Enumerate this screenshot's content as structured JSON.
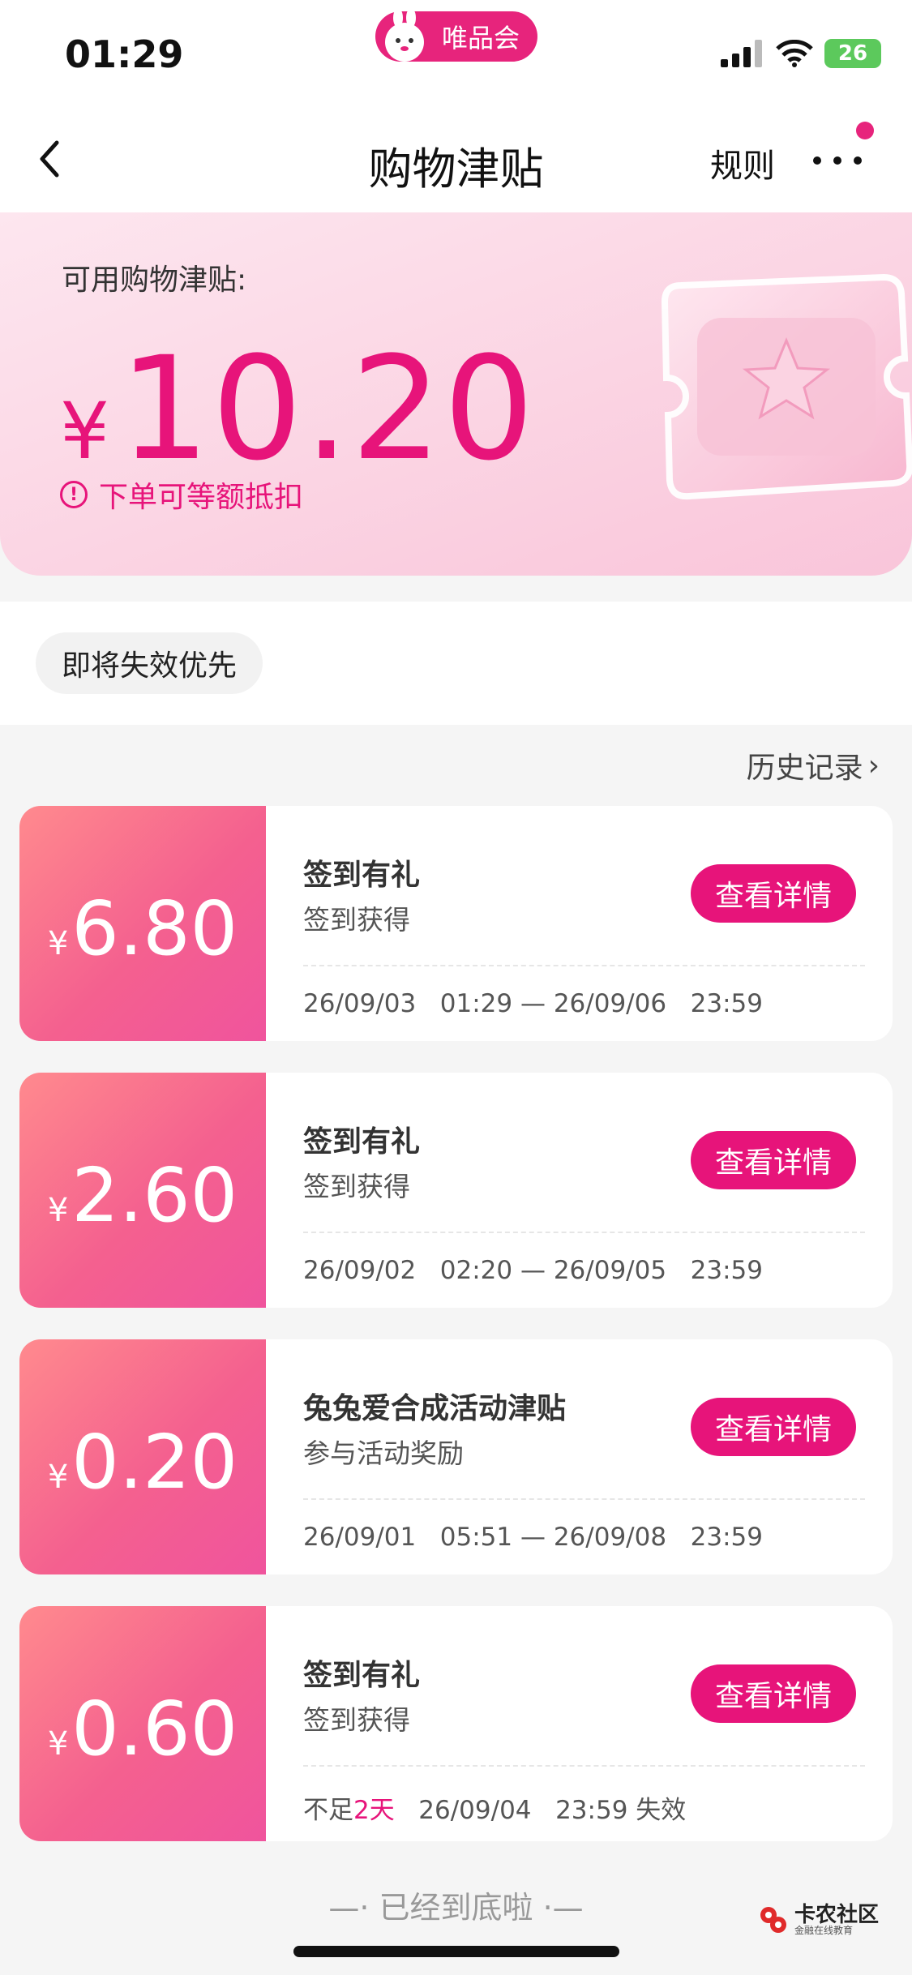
{
  "status": {
    "time": "01:29",
    "app_name": "唯品会",
    "battery": "26"
  },
  "nav": {
    "title": "购物津贴",
    "rules_label": "规则"
  },
  "hero": {
    "label": "可用购物津贴:",
    "currency": "¥",
    "amount": "10.20",
    "tip": "下单可等额抵扣",
    "tip_icon_glyph": "!"
  },
  "filter": {
    "chip_label": "即将失效优先"
  },
  "history": {
    "label": "历史记录",
    "arrow": "›"
  },
  "cards": [
    {
      "currency": "¥",
      "amount": "6.80",
      "title": "签到有礼",
      "subtitle": "签到获得",
      "button": "查看详情",
      "date_line": "26/09/03   01:29 — 26/09/06   23:59"
    },
    {
      "currency": "¥",
      "amount": "2.60",
      "title": "签到有礼",
      "subtitle": "签到获得",
      "button": "查看详情",
      "date_line": "26/09/02   02:20 — 26/09/05   23:59"
    },
    {
      "currency": "¥",
      "amount": "0.20",
      "title": "兔兔爱合成活动津贴",
      "subtitle": "参与活动奖励",
      "button": "查看详情",
      "date_line": "26/09/01   05:51 — 26/09/08   23:59"
    },
    {
      "currency": "¥",
      "amount": "0.60",
      "title": "签到有礼",
      "subtitle": "签到获得",
      "button": "查看详情",
      "expire_prefix": "不足",
      "expire_highlight": "2天",
      "expire_suffix": "   26/09/04   23:59 失效"
    }
  ],
  "footer": {
    "end_note": "—· 已经到底啦 ·—",
    "watermark_main": "卡农社区",
    "watermark_sub": "金融在线教育"
  },
  "colors": {
    "brand": "#e7147a",
    "card_gradient_start": "#ff8a8e",
    "card_gradient_end": "#f0549d"
  }
}
